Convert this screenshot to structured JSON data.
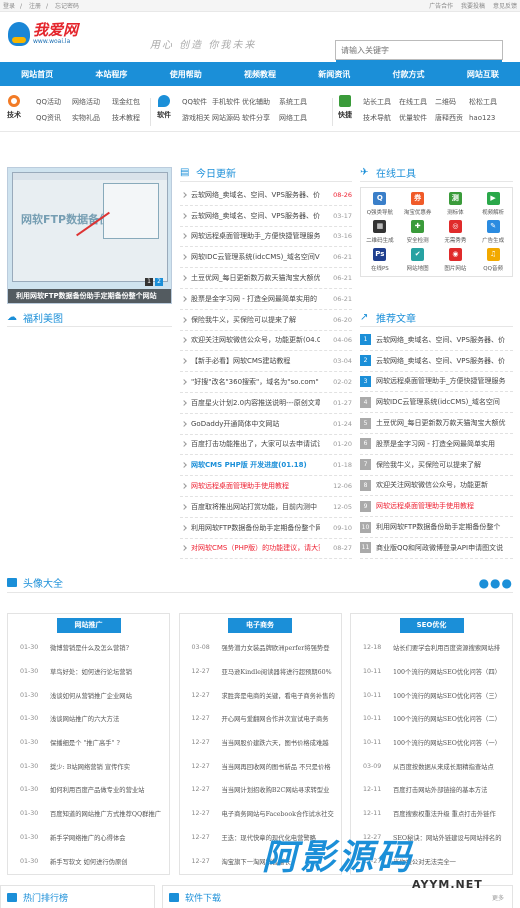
{
  "topbar": {
    "login": "登录",
    "register": "注册",
    "forgot": "忘记密码",
    "ad": "广告合作",
    "complaint": "我要投稿",
    "feedback": "意见反馈",
    "sep": "/"
  },
  "header": {
    "logo_main": "我爱网",
    "logo_sub": "www.woai.la",
    "slogan": "用心 创造 你我未来",
    "search_placeholder": "请输入关键字"
  },
  "nav": [
    "网站首页",
    "本站程序",
    "使用帮助",
    "视频教程",
    "新闻资讯",
    "付款方式",
    "网站互联"
  ],
  "quick": [
    {
      "name": "技术",
      "color": "#f27b26",
      "links": [
        "QQ活动",
        "网络活动",
        "现金红包",
        "QQ资讯",
        "实物礼品",
        "技术教程"
      ]
    },
    {
      "name": "软件",
      "color": "#1b8fd8",
      "links": [
        "QQ软件",
        "手机软件",
        "优化辅助",
        "系统工具",
        "游戏相关",
        "网站源码",
        "软件分享",
        "网络工具"
      ]
    },
    {
      "name": "快捷",
      "color": "#3a9b3a",
      "links": [
        "站长工具",
        "在线工具",
        "二维码",
        "松松工具",
        "技术导航",
        "优量软件",
        "唐释西贡",
        "hao123"
      ]
    }
  ],
  "slide": {
    "caption": "利用网软FTP数据备份助手定期备份整个网站",
    "big_text": "网软FTP数据备份助手",
    "dots": [
      "1",
      "2"
    ]
  },
  "beauty": {
    "title": "福利美图"
  },
  "news": {
    "title": "今日更新",
    "items": [
      {
        "t": "云软网络_卖域名、空间、VPS服务器、价格",
        "d": "08-26",
        "s": "date-red"
      },
      {
        "t": "云软网络_卖域名、空间、VPS服务器、价格",
        "d": "03-17",
        "s": ""
      },
      {
        "t": "网软远程桌面管理助手_方便快捷管理服务器",
        "d": "03-16",
        "s": ""
      },
      {
        "t": "网软IDC云管理系统(idcCMS)_域名空间VPS",
        "d": "06-21",
        "s": ""
      },
      {
        "t": "土豆优网_每日更新数万款天猫淘宝大额优惠",
        "d": "06-21",
        "s": ""
      },
      {
        "t": "股票是金字习网 - 打造全网最简单实用的",
        "d": "06-21",
        "s": ""
      },
      {
        "t": "保险我牛义，买保险可以提来了解",
        "d": "06-20",
        "s": ""
      },
      {
        "t": "欢迎关注网软微信公众号，功能更新(04.06)",
        "d": "04-06",
        "s": ""
      },
      {
        "t": "【新手必看】网软CMS建站教程",
        "d": "03-04",
        "s": ""
      },
      {
        "t": "\"好搜\"改名\"360搜索\"，域名为\"so.com\"",
        "d": "02-02",
        "s": ""
      },
      {
        "t": "百度星火计划2.0内容推送说明---原创文章",
        "d": "01-27",
        "s": ""
      },
      {
        "t": "GoDaddy开通简体中文网站",
        "d": "01-24",
        "s": ""
      },
      {
        "t": "百度打击功能推出了，大家可以去申请试试~",
        "d": "01-20",
        "s": ""
      },
      {
        "t": "网软CMS PHP版 开发进度(01.18)",
        "d": "01-18",
        "s": "blue"
      },
      {
        "t": "网软远程桌面管理助手使用教程",
        "d": "12-06",
        "s": "red"
      },
      {
        "t": "百度取将推出网站打赏功能，目前内测中",
        "d": "12-05",
        "s": ""
      },
      {
        "t": "利用网软FTP数据备份助手定期备份整个网",
        "d": "09-10",
        "s": ""
      },
      {
        "t": "对网软CMS（PHP版）的功能建议，请大家",
        "d": "08-27",
        "s": "red"
      }
    ]
  },
  "tools": {
    "title": "在线工具",
    "items": [
      {
        "n": "Q强类导航",
        "c": "#3a7fc9",
        "g": "Q"
      },
      {
        "n": "淘宝优惠券",
        "c": "#f05a28",
        "g": "券"
      },
      {
        "n": "测标体",
        "c": "#3a9b3a",
        "g": "测"
      },
      {
        "n": "视频解析",
        "c": "#2aa84a",
        "g": "▶"
      },
      {
        "n": "二维码生成",
        "c": "#333333",
        "g": "▦"
      },
      {
        "n": "安全检测",
        "c": "#3a9b3a",
        "g": "✚"
      },
      {
        "n": "无需秀秀",
        "c": "#e02b2b",
        "g": "◎"
      },
      {
        "n": "广告生成",
        "c": "#2b8be0",
        "g": "✎"
      },
      {
        "n": "在线PS",
        "c": "#1f3f8f",
        "g": "Ps"
      },
      {
        "n": "网站地图",
        "c": "#27a2a2",
        "g": "✔"
      },
      {
        "n": "图片网站",
        "c": "#e02b2b",
        "g": "◉"
      },
      {
        "n": "QQ音频",
        "c": "#f2a900",
        "g": "♫"
      }
    ]
  },
  "rec": {
    "title": "推荐文章",
    "items": [
      {
        "t": "云软网络_卖域名、空间、VPS服务器、价",
        "s": ""
      },
      {
        "t": "云软网络_卖域名、空间、VPS服务器、价",
        "s": ""
      },
      {
        "t": "网软远程桌面管理助手_方便快捷管理服务",
        "s": ""
      },
      {
        "t": "网软IDC云管理系统(idcCMS)_域名空间",
        "s": ""
      },
      {
        "t": "土豆优网_每日更新数万款天猫淘宝大额优",
        "s": ""
      },
      {
        "t": "股票是金字习网 - 打造全网最简单实用",
        "s": ""
      },
      {
        "t": "保险我牛义，买保险可以提来了解",
        "s": ""
      },
      {
        "t": "欢迎关注网软微信公众号，功能更新",
        "s": ""
      },
      {
        "t": "网软远程桌面管理助手使用教程",
        "s": "red"
      },
      {
        "t": "利用网软FTP数据备份助手定期备份整个",
        "s": ""
      },
      {
        "t": "商业版QQ和阿政微博登录API申请图文说",
        "s": ""
      }
    ],
    "nums": [
      "1",
      "2",
      "3",
      "4",
      "5",
      "6",
      "7",
      "8",
      "9",
      "10",
      "11"
    ]
  },
  "avatar": {
    "title": "头像大全",
    "more": "●●●"
  },
  "columns": [
    {
      "title": "网站推广",
      "items": [
        [
          "01-30",
          "微博营销是什么及怎么营销?"
        ],
        [
          "01-30",
          "草鸟好处：如何进行论坛营销"
        ],
        [
          "01-30",
          "浅谈如何从营销推广企业网站"
        ],
        [
          "01-30",
          "浅谈网站推广的六大方法"
        ],
        [
          "01-30",
          "保播细是个 \"推广高手\" ?"
        ],
        [
          "01-30",
          "奨少: B站网络营销 宣传作实"
        ],
        [
          "01-30",
          "如何利用百度产品做专业的营业站"
        ],
        [
          "01-30",
          "百度知道的网站推广方式推荐QQ群推广"
        ],
        [
          "01-30",
          "新手学网络推广的心得体会"
        ],
        [
          "01-30",
          "新手写软文 如何进行伪原创"
        ]
      ]
    },
    {
      "title": "电子商务",
      "items": [
        [
          "03-08",
          "强势潜力女装品牌欧洲perfer将强势登"
        ],
        [
          "12-27",
          "亚马逊Kindle阅读器将进行超预期60%"
        ],
        [
          "12-27",
          "求胜奔是电商的关键，看电子商务补售的"
        ],
        [
          "12-27",
          "开心网与爱翻网合作并次宣试电子商务"
        ],
        [
          "12-27",
          "当当网股价建跌六天，图书价格成难越"
        ],
        [
          "12-27",
          "当当网再回收网的图书新品 不只是价格"
        ],
        [
          "12-27",
          "当当网计划招收购B2C网站寻求转型业"
        ],
        [
          "12-27",
          "电子商务网站与Facebook合作试水社交"
        ],
        [
          "12-27",
          "王迭：现代快章的现代化电营警略"
        ],
        [
          "12-27",
          "淘宝旗下一淘网销售增长"
        ]
      ]
    },
    {
      "title": "SEO优化",
      "items": [
        [
          "12-18",
          "站长们要学会利用百度资源搜索网站排"
        ],
        [
          "10-11",
          "100个流行的网站SEO优化问答（四）"
        ],
        [
          "10-11",
          "100个流行的网站SEO优化问答（三）"
        ],
        [
          "10-11",
          "100个流行的网站SEO优化问答（二）"
        ],
        [
          "10-11",
          "100个流行的网站SEO优化问答（一）"
        ],
        [
          "03-09",
          "从百度按数据从来成长期精指查站点"
        ],
        [
          "12-11",
          "百度打击网站外部链接的基本方法"
        ],
        [
          "12-11",
          "百度搜索权重法升级 重点打击外链作"
        ],
        [
          "12-27",
          "SEO秘诀：网站外链建设与网站排名的"
        ],
        [
          "12-27",
          "当你被公对无法完全一"
        ]
      ]
    }
  ],
  "bottom": {
    "rank": "热门排行榜",
    "download": "软件下载",
    "more": "更多"
  },
  "watermark": {
    "main": "阿影源码",
    "sub": "AYYM.NET"
  }
}
